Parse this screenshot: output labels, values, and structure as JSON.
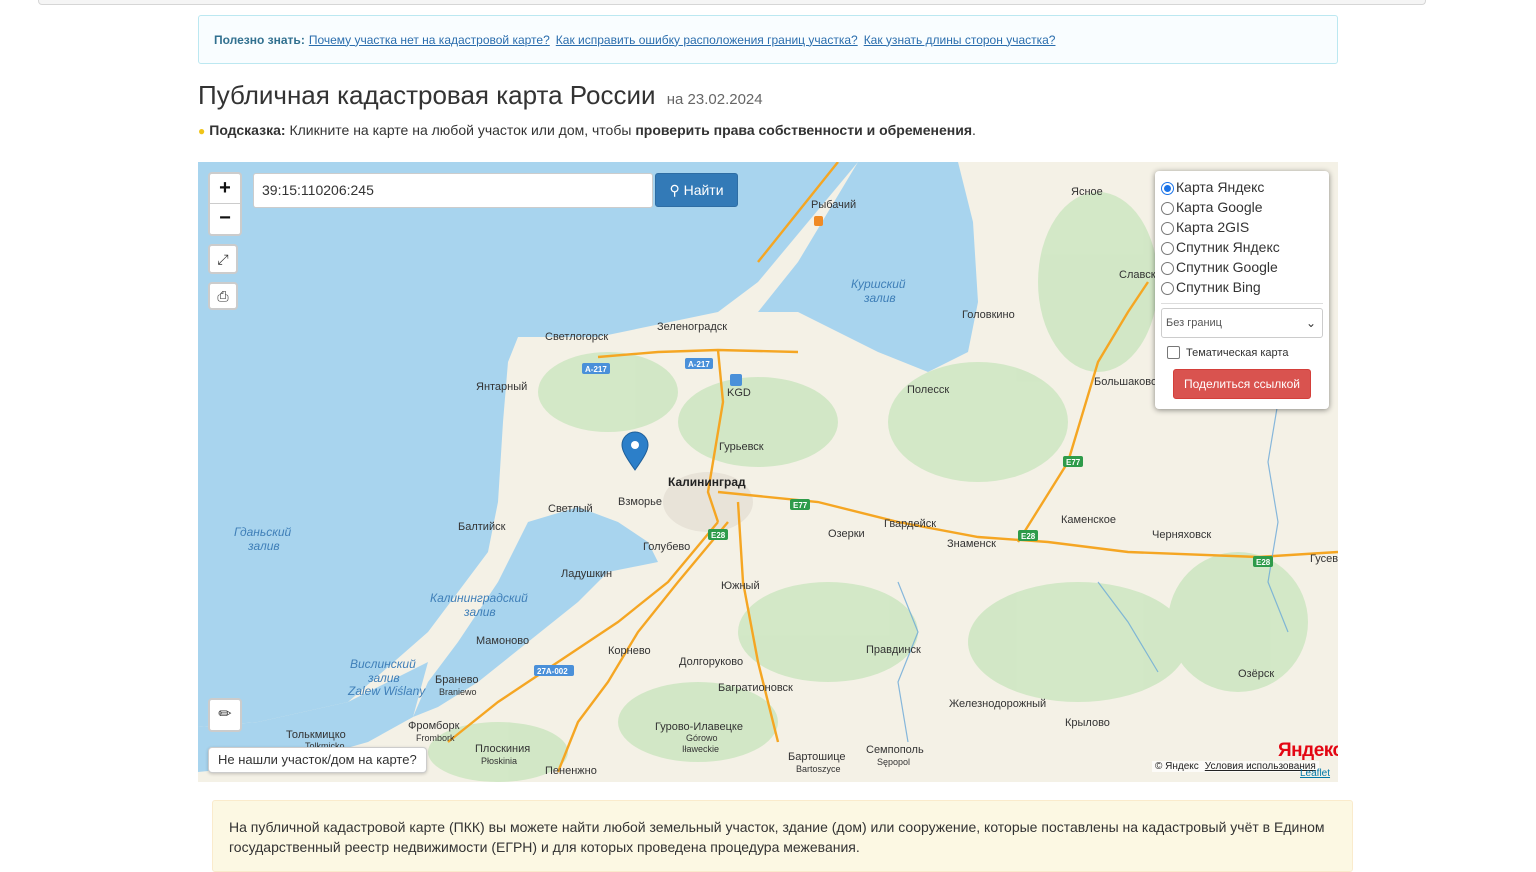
{
  "notice": {
    "label": "Полезно знать:",
    "links": [
      "Почему участка нет на кадастровой карте?",
      "Как исправить ошибку расположения границ участка?",
      "Как узнать длины сторон участка?"
    ]
  },
  "page": {
    "title": "Публичная кадастровая карта России",
    "date": "на 23.02.2024",
    "hint_label": "Подсказка:",
    "hint_text": "Кликните на карте на любой участок или дом, чтобы",
    "hint_bold": "проверить права собственности и обременения",
    "hint_end": "."
  },
  "map": {
    "search_value": "39:15:110206:245",
    "find_label": "Найти",
    "zoom_in": "+",
    "zoom_out": "−",
    "layers": [
      "Карта Яндекс",
      "Карта Google",
      "Карта 2GIS",
      "Спутник Яндекс",
      "Спутник Google",
      "Спутник Bing"
    ],
    "selected_layer": "Карта Яндекс",
    "borders_select": "Без границ",
    "thematic_label": "Тематическая карта",
    "share_label": "Поделиться ссылкой",
    "not_found": "Не нашли участок/дом на карте?",
    "copyright": "© Яндекс",
    "terms": "Условия использования",
    "leaflet": "Leaflet",
    "logo": "Яндекс",
    "places": {
      "kaliningrad": "Калининград",
      "svetlogorsk": "Светлогорск",
      "zelenogradsk": "Зеленоградск",
      "rybachy": "Рыбачий",
      "yantarny": "Янтарный",
      "kgd": "KGD",
      "guryevsk": "Гурьевск",
      "vzmorye": "Взморье",
      "svetly": "Светлый",
      "baltiysk": "Балтийск",
      "golubevo": "Голубево",
      "ladushkin": "Ладушкин",
      "yuzhny": "Южный",
      "mamonovo": "Мамоново",
      "korneevo": "Корнево",
      "dolgorukovo": "Долгоруково",
      "bagrationovsk": "Багратионовск",
      "branevo": "Бранево",
      "braniewo": "Braniewo",
      "frombork_ru": "Фромборк",
      "frombork": "Frombork",
      "tolkmicko_ru": "Толькмицко",
      "tolkmicko": "Tolkmicko",
      "ploskinia_ru": "Плоскиния",
      "ploskinia": "Płoskinia",
      "pieniezno_ru": "Пененжно",
      "pieniezno": "Pieniężno",
      "gurovo": "Гурово-Илавецке",
      "gorowo": "Górowo",
      "ilaweckie": "Iławeckie",
      "bartoshitse": "Бартошице",
      "bartoszyce": "Bartoszyce",
      "sempopol": "Семпополь",
      "sepopol": "Sępopol",
      "pravdinsk": "Правдинск",
      "zheleznodorozhny": "Железнодорожный",
      "krylovo": "Крылово",
      "ozersk": "Озёрск",
      "gvardeysk": "Гвардейск",
      "ozerki": "Озерки",
      "znamensk": "Знаменск",
      "kamenskoe": "Каменское",
      "chernyakhovsk": "Черняховск",
      "gusev": "Гусев",
      "polessk": "Полесск",
      "golovkino": "Головкино",
      "bolshakovo": "Большаково",
      "slavsk": "Славск",
      "yasnoe": "Ясное"
    },
    "water": {
      "kurshsky": [
        "Куршский",
        "залив"
      ],
      "gdansk": [
        "Гданьский",
        "залив"
      ],
      "kaliningradsky": [
        "Калининградский",
        "залив"
      ],
      "vislinsky": [
        "Вислинский",
        "залив",
        "Zalew Wiślany"
      ]
    },
    "roads": [
      "A-217",
      "A-217",
      "E77",
      "E28",
      "E28",
      "E28",
      "E77",
      "27A-002",
      "E77"
    ]
  },
  "info": {
    "text": "На публичной кадастровой карте (ПКК) вы можете найти любой земельный участок, здание (дом) или сооружение, которые поставлены на кадастровый учёт в Едином государственный реестр недвижимости (ЕГРН) и для которых проведена процедура межевания."
  },
  "colors": {
    "water": "#a8d4ee",
    "land": "#f4f1e6",
    "road": "#f5a623",
    "primary": "#337ab7",
    "danger": "#d9534f"
  }
}
